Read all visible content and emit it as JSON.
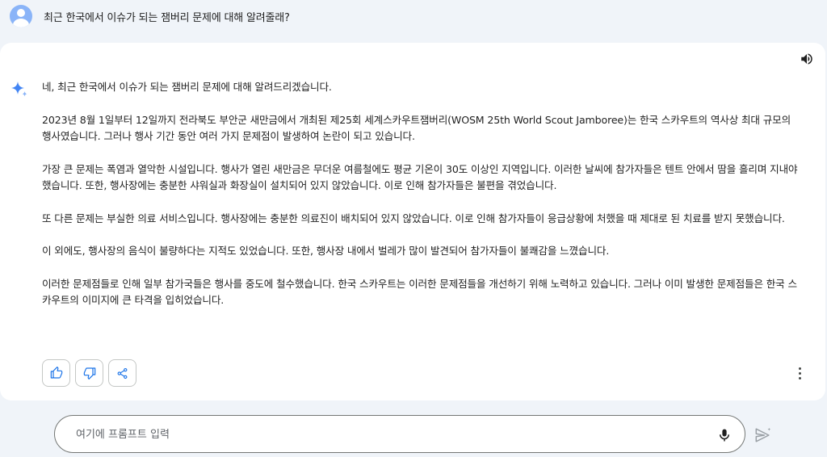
{
  "user": {
    "prompt": "최근 한국에서 이슈가 되는 잼버리 문제에 대해 알려줄래?"
  },
  "response": {
    "paragraphs": [
      "네, 최근 한국에서 이슈가 되는 잼버리 문제에 대해 알려드리겠습니다.",
      "2023년 8월 1일부터 12일까지 전라북도 부안군 새만금에서 개최된 제25회 세계스카우트잼버리(WOSM 25th World Scout Jamboree)는 한국 스카우트의 역사상 최대 규모의 행사였습니다. 그러나 행사 기간 동안 여러 가지 문제점이 발생하여 논란이 되고 있습니다.",
      "가장 큰 문제는 폭염과 열악한 시설입니다. 행사가 열린 새만금은 무더운 여름철에도 평균 기온이 30도 이상인 지역입니다. 이러한 날씨에 참가자들은 텐트 안에서 땀을 흘리며 지내야 했습니다. 또한, 행사장에는 충분한 샤워실과 화장실이 설치되어 있지 않았습니다. 이로 인해 참가자들은 불편을 겪었습니다.",
      "또 다른 문제는 부실한 의료 서비스입니다. 행사장에는 충분한 의료진이 배치되어 있지 않았습니다. 이로 인해 참가자들이 응급상황에 처했을 때 제대로 된 치료를 받지 못했습니다.",
      "이 외에도, 행사장의 음식이 불량하다는 지적도 있었습니다. 또한, 행사장 내에서 벌레가 많이 발견되어 참가자들이 불쾌감을 느꼈습니다.",
      "이러한 문제점들로 인해 일부 참가국들은 행사를 중도에 철수했습니다. 한국 스카우트는 이러한 문제점들을 개선하기 위해 노력하고 있습니다. 그러나 이미 발생한 문제점들은 한국 스카우트의 이미지에 큰 타격을 입히었습니다."
    ]
  },
  "actions": {
    "icons": [
      "thumbs-up-icon",
      "thumbs-down-icon",
      "share-icon",
      "more-vert-icon",
      "speaker-icon"
    ]
  },
  "input": {
    "placeholder": "여기에 프롬프트 입력",
    "value": ""
  },
  "colors": {
    "background": "#f0f4f9",
    "card": "#ffffff",
    "accent": "#4285f4",
    "icon": "#444746"
  }
}
